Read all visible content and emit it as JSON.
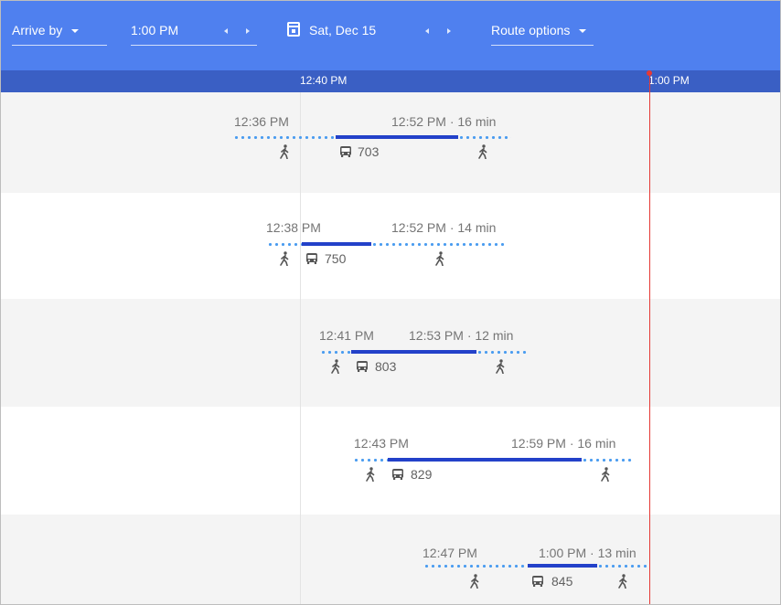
{
  "toolbar": {
    "arrive_by": "Arrive by",
    "time": "1:00 PM",
    "date": "Sat, Dec 15",
    "route_options": "Route options"
  },
  "ruler": {
    "left_label": "12:40 PM",
    "right_label": "1:00 PM"
  },
  "colors": {
    "toolbar": "#4f80ef",
    "ruler": "#3a5fc4",
    "bus_line": "#2341c9",
    "walk_dots": "#4a9cf0",
    "current_time_line": "#e53935"
  },
  "trips": [
    {
      "depart": "12:36 PM",
      "arrive": "12:52 PM · 16 min",
      "route": "703"
    },
    {
      "depart": "12:38 PM",
      "arrive": "12:52 PM · 14 min",
      "route": "750"
    },
    {
      "depart": "12:41 PM",
      "arrive": "12:53 PM · 12 min",
      "route": "803"
    },
    {
      "depart": "12:43 PM",
      "arrive": "12:59 PM · 16 min",
      "route": "829"
    },
    {
      "depart": "12:47 PM",
      "arrive": "1:00 PM · 13 min",
      "route": "845"
    }
  ]
}
